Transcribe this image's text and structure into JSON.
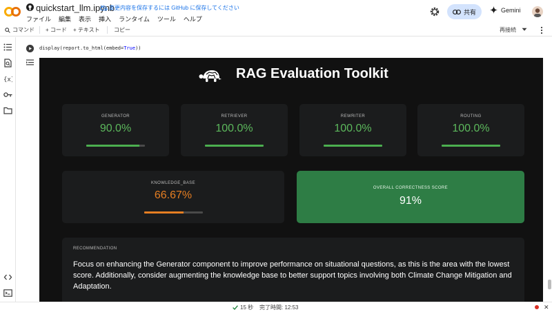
{
  "notebook": {
    "title": "quickstart_llm.ipynb",
    "save_note": "変更内容を保存するには GitHub に保存してください",
    "menus": [
      "ファイル",
      "編集",
      "表示",
      "挿入",
      "ランタイム",
      "ツール",
      "ヘルプ"
    ]
  },
  "header": {
    "share_label": "共有",
    "gemini_label": "Gemini"
  },
  "toolbar": {
    "command_label": "コマンド",
    "code_label": "+ コード",
    "text_label": "+ テキスト",
    "copy_label": "コピー",
    "reconnect_label": "再接続"
  },
  "cell": {
    "code_fn": "display(report.to_html(embed=",
    "code_kw": "True",
    "code_end": "))"
  },
  "report": {
    "title": "RAG Evaluation Toolkit",
    "metrics": [
      {
        "label": "GENERATOR",
        "value": "90.0%",
        "fraction": 0.9,
        "color": "#4caf50"
      },
      {
        "label": "RETRIEVER",
        "value": "100.0%",
        "fraction": 1.0,
        "color": "#4caf50"
      },
      {
        "label": "REWRITER",
        "value": "100.0%",
        "fraction": 1.0,
        "color": "#4caf50"
      },
      {
        "label": "ROUTING",
        "value": "100.0%",
        "fraction": 1.0,
        "color": "#4caf50"
      }
    ],
    "knowledge_base": {
      "label": "KNOWLEDGE_BASE",
      "value": "66.67%",
      "fraction": 0.6667,
      "color": "#e67e22"
    },
    "overall": {
      "label": "OVERALL CORRECTNESS SCORE",
      "value": "91%",
      "color": "#2e7d45"
    },
    "recommendation": {
      "label": "RECOMMENDATION",
      "text": "Focus on enhancing the Generator component to improve performance on situational questions, as this is the area with the lowest score. Additionally, consider augmenting the knowledge base to better support topics involving both Climate Change Mitigation and Adaptation."
    }
  },
  "status": {
    "elapsed": "15 秒",
    "completed": "完了時間: 12:53"
  },
  "icons": [
    "colab-logo-icon",
    "github-icon",
    "cloud-off-icon",
    "gear-icon",
    "link-icon",
    "gemini-spark-icon",
    "search-icon",
    "chevron-down-icon",
    "more-vert-icon",
    "toc-icon",
    "find-icon",
    "variables-icon",
    "secrets-key-icon",
    "folder-icon",
    "code-brackets-icon",
    "terminal-icon",
    "play-icon",
    "output-toggle-icon",
    "turtle-logo-icon",
    "check-icon",
    "close-icon"
  ]
}
